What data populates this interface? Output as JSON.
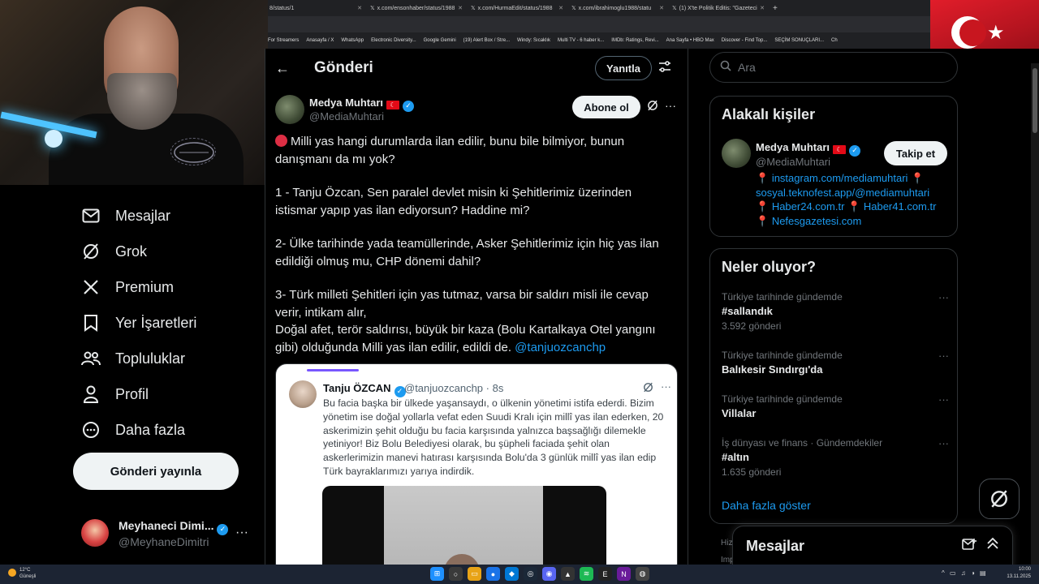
{
  "browser": {
    "tabs": [
      {
        "title": "8/status/1"
      },
      {
        "title": "x.com/ensonhaber/status/1988"
      },
      {
        "title": "x.com/HurmaEdit/status/1988"
      },
      {
        "title": "x.com/ibrahimoglu1988/statu"
      },
      {
        "title": "(1) X'te Politik Editis: \"Gazeteci"
      }
    ],
    "new_tab": "+",
    "bookmarks": [
      "For Streamers",
      "Anasayfa / X",
      "WhatsApp",
      "Electronic Diversity...",
      "Google Gemini",
      "(19) Alert Box / Stre...",
      "Windy: Sıcaklık",
      "Multi TV - 6 haber k...",
      "IMDb: Ratings, Revi...",
      "Ana Sayfa • HBO Max",
      "Discover - Find Top...",
      "SEÇİM SONUÇLARI...",
      "Ch"
    ]
  },
  "nav": {
    "items": [
      {
        "label": "Mesajlar",
        "icon": "mail-icon"
      },
      {
        "label": "Grok",
        "icon": "grok-icon"
      },
      {
        "label": "Premium",
        "icon": "x-logo-icon"
      },
      {
        "label": "Yer İşaretleri",
        "icon": "bookmark-icon"
      },
      {
        "label": "Topluluklar",
        "icon": "communities-icon"
      },
      {
        "label": "Profil",
        "icon": "profile-icon"
      },
      {
        "label": "Daha fazla",
        "icon": "more-circle-icon"
      }
    ],
    "post_button": "Gönderi yayınla",
    "account": {
      "name": "Meyhaneci Dimi...",
      "handle": "@MeyhaneDimitri"
    }
  },
  "post": {
    "header_title": "Gönderi",
    "reply_button": "Yanıtla",
    "author": {
      "name": "Medya Muhtarı",
      "handle": "@MediaMuhtari"
    },
    "follow_button": "Abone ol",
    "paragraphs": [
      "Milli yas hangi durumlarda ilan edilir, bunu bile bilmiyor, bunun danışmanı da mı yok?",
      "1 - Tanju Özcan, Sen paralel devlet misin ki Şehitlerimiz üzerinden istismar yapıp yas ilan ediyorsun? Haddine mi?",
      "2- Ülke tarihinde yada teamüllerinde, Asker Şehitlerimiz için hiç yas ilan edildiği olmuş mu, CHP dönemi dahil?",
      "3- Türk milleti Şehitleri için yas tutmaz, varsa bir saldırı misli ile cevap verir, intikam alır,",
      "Doğal afet, terör saldırısı, büyük bir kaza (Bolu Kartalkaya Otel yangını gibi) olduğunda Milli yas ilan edilir, edildi de."
    ],
    "mention": "@tanjuozcanchp",
    "quote": {
      "name": "Tanju ÖZCAN",
      "handle": "@tanjuozcanchp · 8s",
      "text": "Bu facia başka bir ülkede yaşansaydı, o ülkenin yönetimi istifa ederdi. Bizim yönetim ise doğal yollarla vefat eden Suudi Kralı için millî yas ilan ederken, 20 askerimizin şehit olduğu bu facia karşısında yalnızca başsağlığı dilemekle yetiniyor! Biz Bolu Belediyesi olarak, bu şüpheli faciada şehit olan askerlerimizin manevi hatırası karşısında Bolu'da 3 günlük millî yas ilan edip Türk bayraklarımızı yarıya indirdik."
    }
  },
  "right": {
    "search_placeholder": "Ara",
    "related": {
      "title": "Alakalı kişiler",
      "name": "Medya Muhtarı",
      "handle": "@MediaMuhtari",
      "follow_button": "Takip et",
      "bio_links": [
        "instagram.com/mediamuhtari",
        "sosyal.teknofest.app/@mediamuhtari",
        "Haber24.com.tr",
        "Haber41.com.tr",
        "Nefesgazetesi.com"
      ]
    },
    "trends": {
      "title": "Neler oluyor?",
      "items": [
        {
          "context": "Türkiye tarihinde gündemde",
          "name": "#sallandık",
          "count": "3.592 gönderi"
        },
        {
          "context": "Türkiye tarihinde gündemde",
          "name": "Balıkesir Sındırgı'da",
          "count": ""
        },
        {
          "context": "Türkiye tarihinde gündemde",
          "name": "Villalar",
          "count": ""
        },
        {
          "context": "İş dünyası ve finans · Gündemdekiler",
          "name": "#altın",
          "count": "1.635 gönderi"
        }
      ],
      "show_more": "Daha fazla göster"
    },
    "messages_drawer": "Mesajlar",
    "footer_1": "Hizı",
    "footer_2": "Imp"
  },
  "taskbar": {
    "weather_temp": "12°C",
    "weather_desc": "Güneşli",
    "time": "10:00",
    "date": "13.11.2025"
  },
  "colors": {
    "accent": "#1d9bf0",
    "flag_red": "#e30a17",
    "background": "#000000"
  }
}
